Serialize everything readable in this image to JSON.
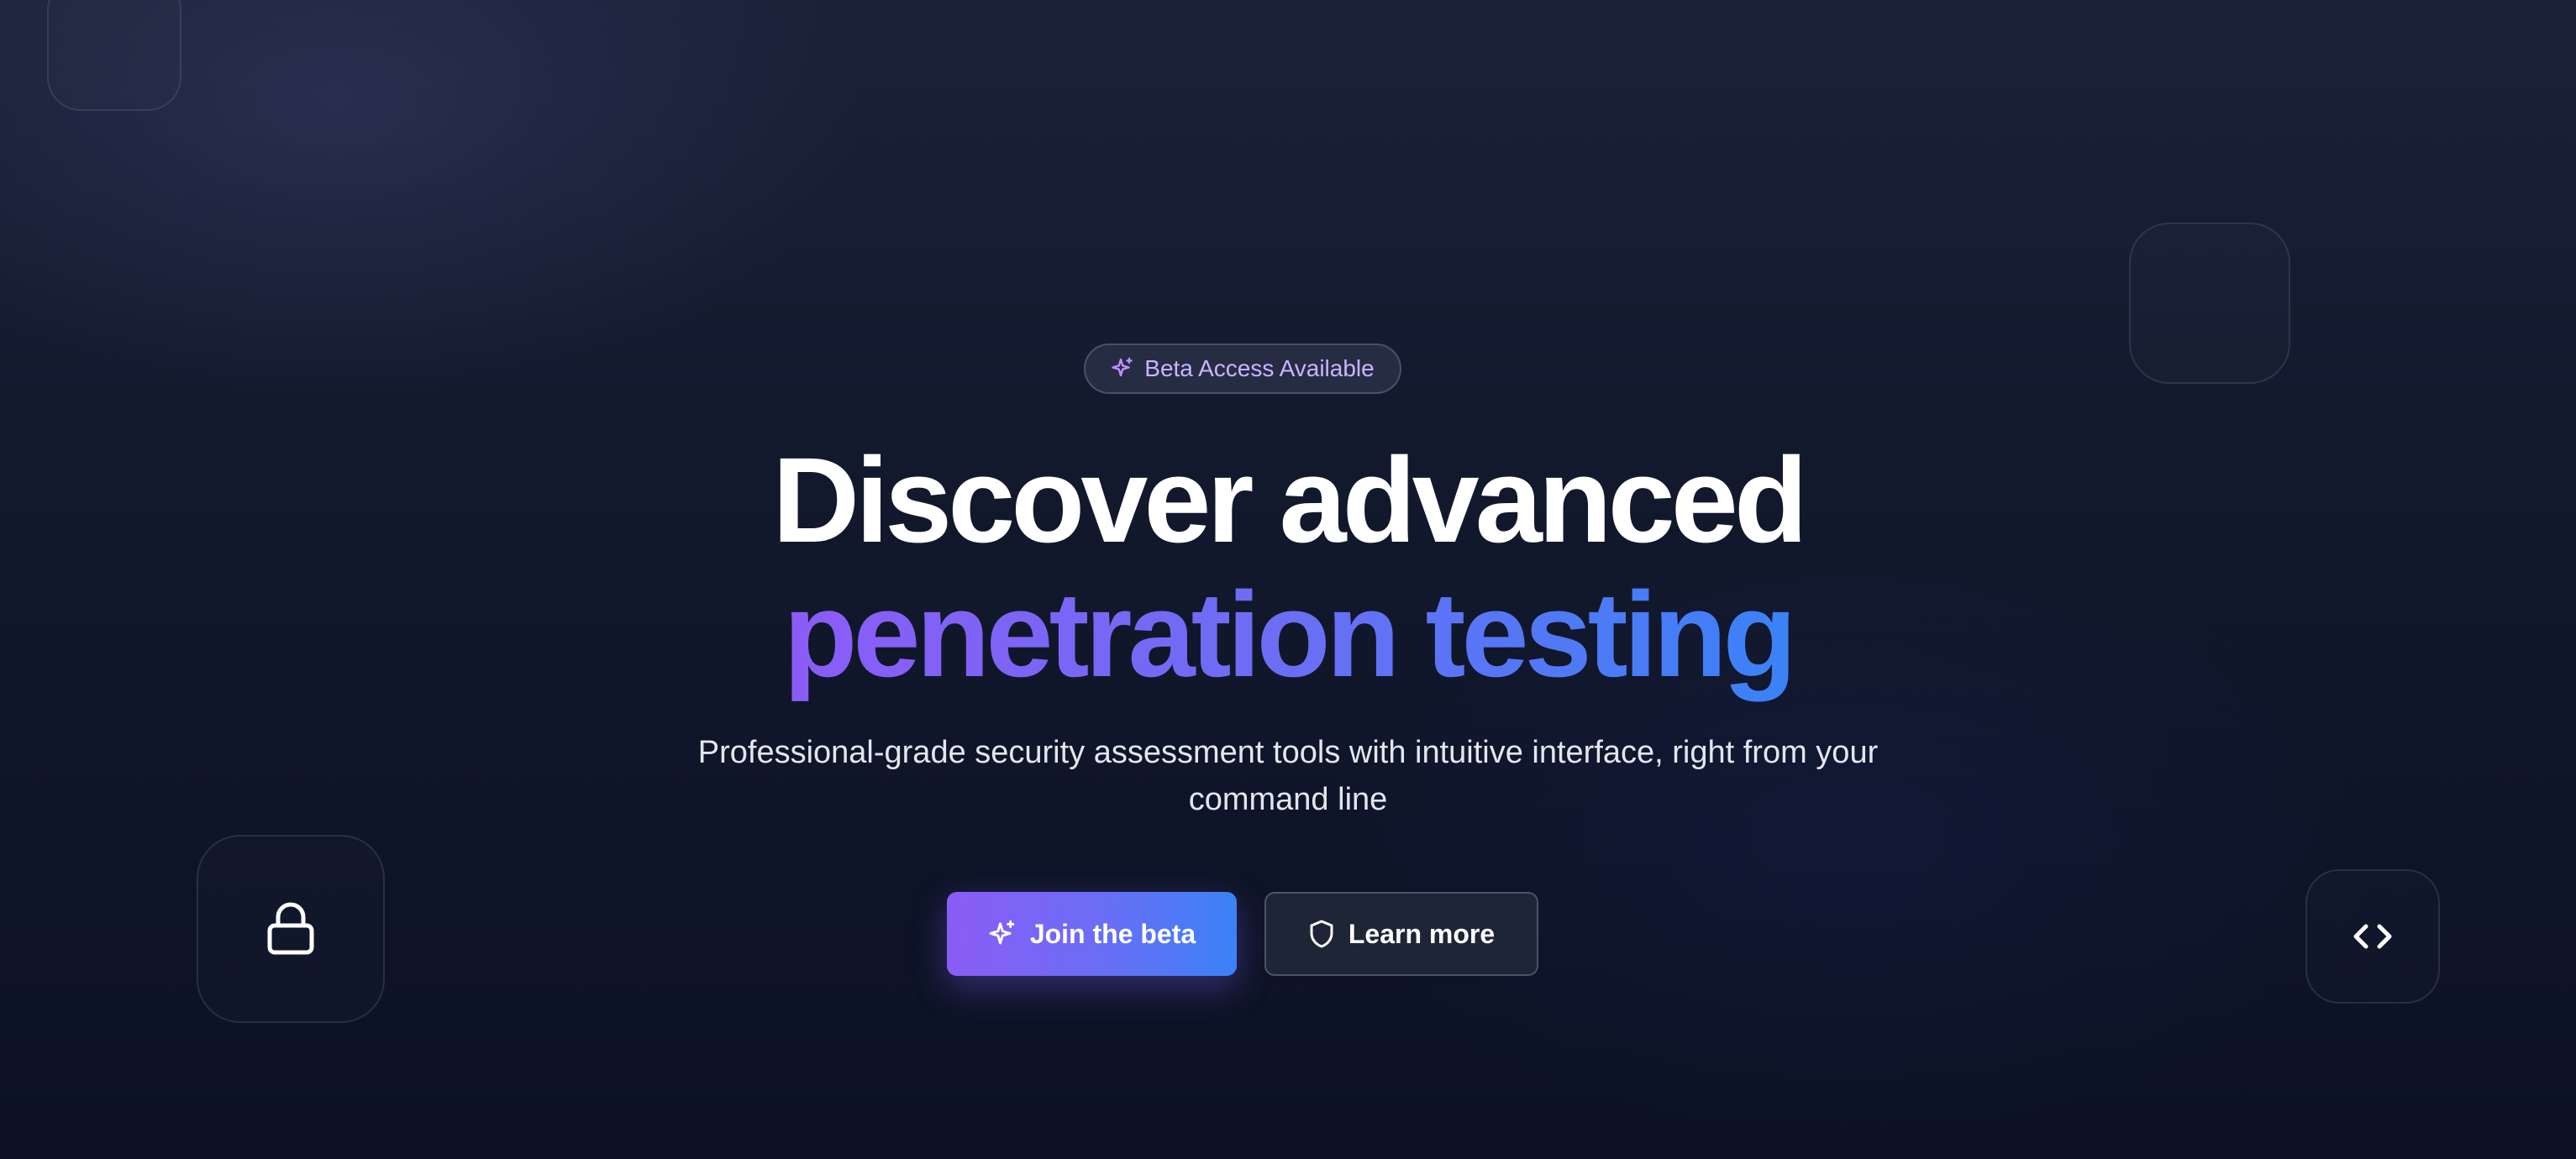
{
  "badge": {
    "label": "Beta Access Available",
    "icon": "sparkles-icon"
  },
  "hero": {
    "headline_line1": "Discover advanced",
    "headline_line2": "penetration testing",
    "subtitle": "Professional-grade security assessment tools with intuitive interface, right from your command line"
  },
  "actions": {
    "primary_label": "Join the beta",
    "primary_icon": "sparkles-icon",
    "secondary_label": "Learn more",
    "secondary_icon": "shield-icon"
  },
  "decorations": {
    "left_tile_icon": "lock-icon",
    "right_tile_icon": "code-icon"
  },
  "colors": {
    "background": "#141a2e",
    "gradient_start": "#8b5cf6",
    "gradient_end": "#3b82f6",
    "badge_text": "#c9b5ff",
    "secondary_button_bg": "#1e2536"
  }
}
